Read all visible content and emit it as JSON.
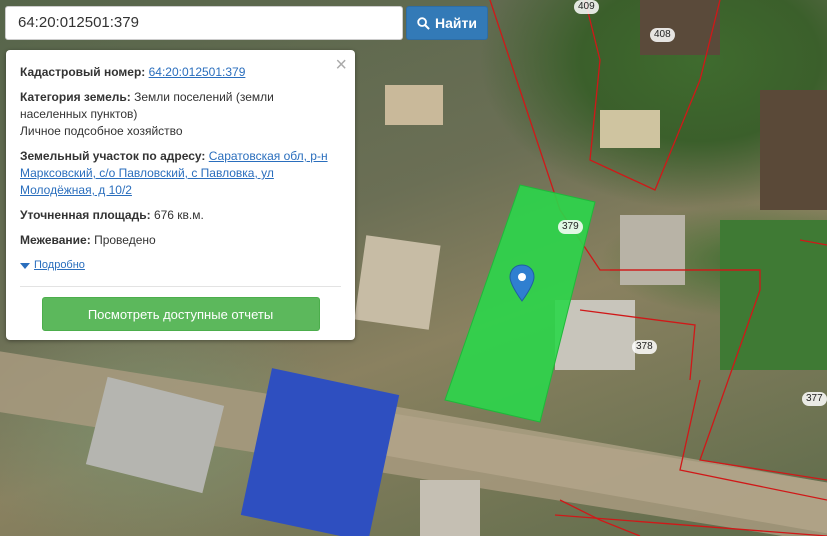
{
  "search": {
    "value": "64:20:012501:379",
    "button_label": "Найти"
  },
  "info": {
    "cadastral_label": "Кадастровый номер:",
    "cadastral_value": "64:20:012501:379",
    "category_label": "Категория земель:",
    "category_value": "Земли поселений (земли населенных пунктов)",
    "usage_value": "Личное подсобное хозяйство",
    "address_label": "Земельный участок по адресу:",
    "address_value": "Саратовская обл, р-н Марксовский, с/о Павловский, с Павловка, ул Молодёжная, д 10/2",
    "area_label": "Уточненная площадь:",
    "area_value": "676 кв.м.",
    "survey_label": "Межевание:",
    "survey_value": "Проведено",
    "more_label": "Подробно",
    "reports_button": "Посмотреть доступные отчеты",
    "close_symbol": "×"
  },
  "map": {
    "parcel_labels": [
      "409",
      "408",
      "379",
      "378",
      "377"
    ],
    "highlight_color": "#2bd64a",
    "boundary_color": "#d01818"
  }
}
